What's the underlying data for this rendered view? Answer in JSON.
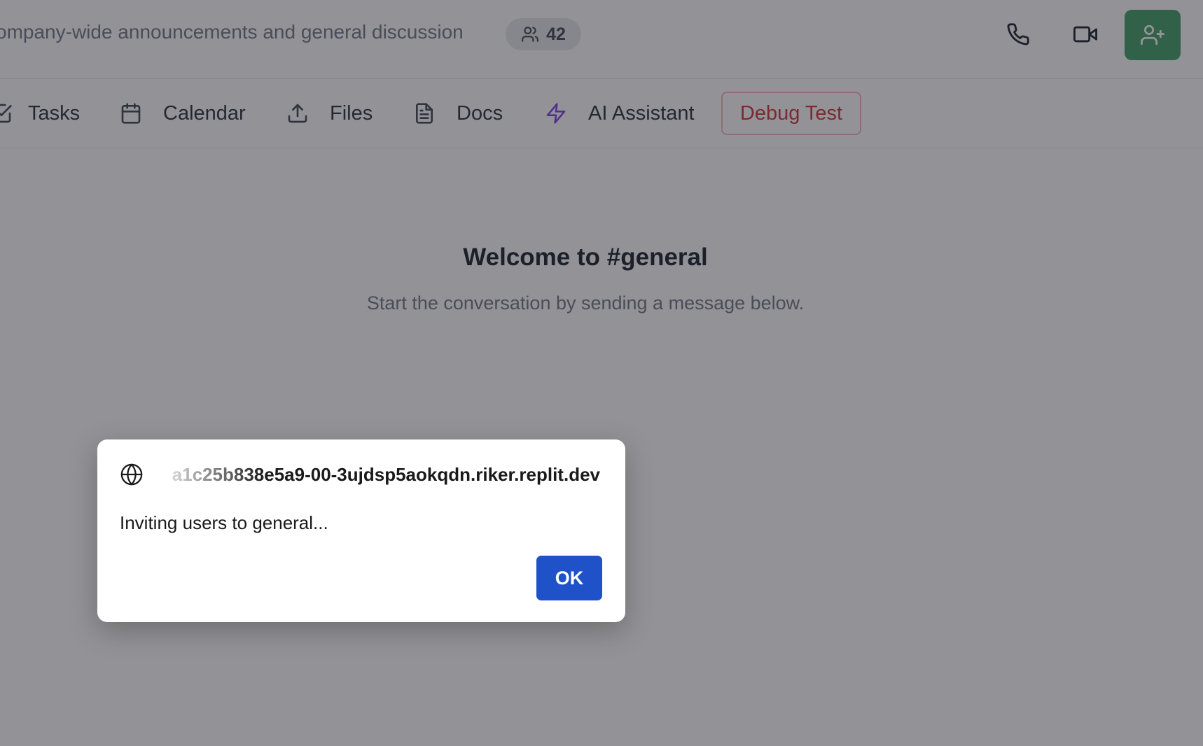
{
  "header": {
    "channel_description": "ompany-wide announcements and general discussion",
    "member_count": "42"
  },
  "tabs": [
    {
      "label": "Tasks",
      "icon": "tasks-icon"
    },
    {
      "label": "Calendar",
      "icon": "calendar-icon"
    },
    {
      "label": "Files",
      "icon": "upload-icon"
    },
    {
      "label": "Docs",
      "icon": "document-icon"
    },
    {
      "label": "AI Assistant",
      "icon": "lightning-icon"
    }
  ],
  "debug_button_label": "Debug Test",
  "empty_state": {
    "title": "Welcome to #general",
    "subtitle": "Start the conversation by sending a message below."
  },
  "dialog": {
    "origin": "a1c25b838e5a9-00-3ujdsp5aokqdn.riker.replit.dev",
    "message": "Inviting users to general...",
    "ok_label": "OK"
  },
  "colors": {
    "invite_button": "#3d9a62",
    "ok_button": "#1f52c9",
    "debug_text": "#c53030",
    "ai_icon": "#7c3aed"
  }
}
